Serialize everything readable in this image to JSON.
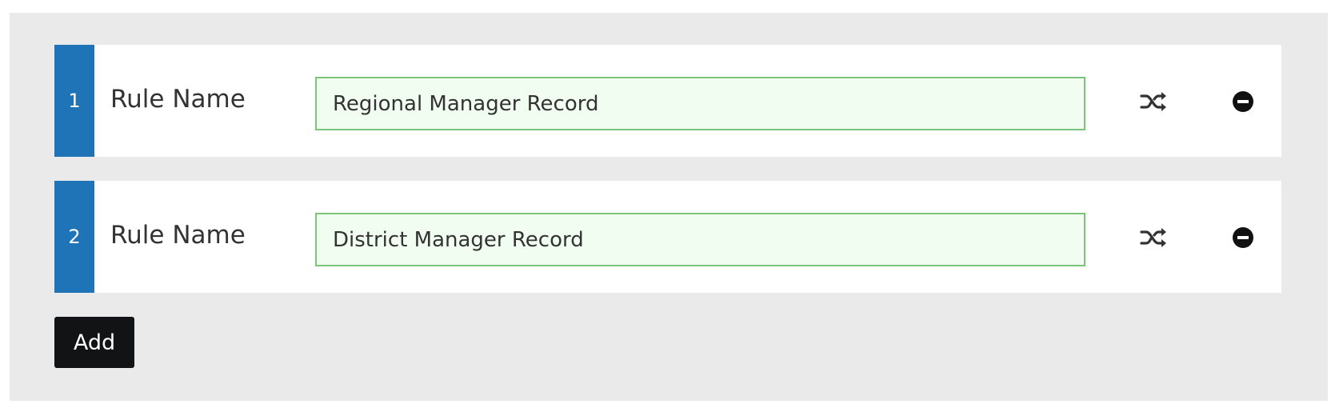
{
  "rules": [
    {
      "index": "1",
      "label": "Rule Name",
      "value": "Regional Manager Record"
    },
    {
      "index": "2",
      "label": "Rule Name",
      "value": "District Manager Record"
    }
  ],
  "icons": {
    "shuffle": "shuffle-icon",
    "remove": "minus-circle-icon"
  },
  "actions": {
    "add_label": "Add"
  },
  "colors": {
    "panel_background": "#eaeaea",
    "index_background": "#1f73b7",
    "input_border": "#7cc37c",
    "input_background": "#f0fdf0",
    "button_background": "#111315"
  }
}
